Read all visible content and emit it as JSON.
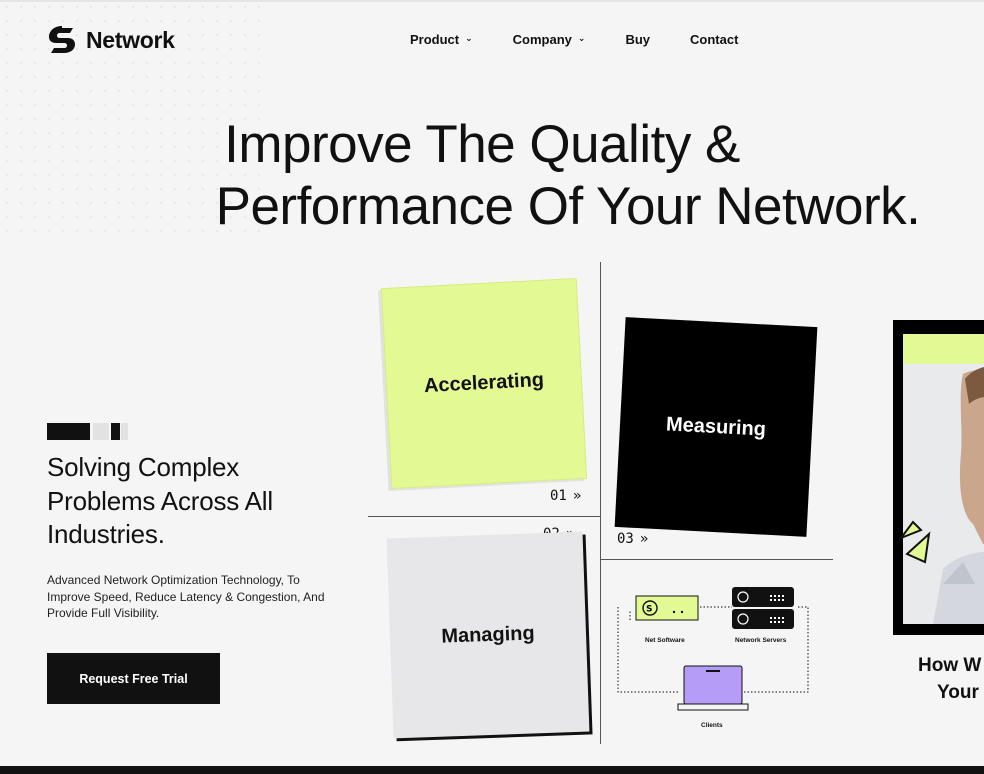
{
  "brand": {
    "name": "Network"
  },
  "nav": {
    "items": [
      {
        "label": "Product",
        "has_dropdown": true
      },
      {
        "label": "Company",
        "has_dropdown": true
      },
      {
        "label": "Buy",
        "has_dropdown": false
      },
      {
        "label": "Contact",
        "has_dropdown": false
      }
    ]
  },
  "hero": {
    "line1": "Improve The Quality &",
    "line2": "Performance Of Your Network."
  },
  "intro": {
    "title": "Solving Complex Problems Across All Industries.",
    "description": "Advanced Network Optimization Technology, To Improve Speed, Reduce Latency & Congestion, And Provide Full Visibility.",
    "cta_label": "Request Free Trial"
  },
  "cards": [
    {
      "label": "Accelerating",
      "number": "01",
      "arrow": "»"
    },
    {
      "label": "Managing",
      "number": "02",
      "arrow": "»"
    },
    {
      "label": "Measuring",
      "number": "03",
      "arrow": "»"
    }
  ],
  "diagram": {
    "nodes": [
      {
        "label": "Net Software"
      },
      {
        "label": "Network Servers"
      },
      {
        "label": "Clients"
      }
    ]
  },
  "side_card": {
    "line1": "How W",
    "line2": "Your"
  },
  "colors": {
    "accent_lime": "#e3f993",
    "dark": "#000000",
    "card_grey": "#e7e7ea",
    "client_purple": "#b59cf7"
  }
}
